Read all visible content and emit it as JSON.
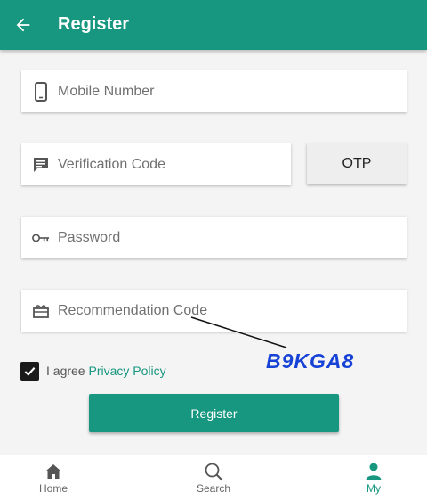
{
  "colors": {
    "primary": "#17977f",
    "annotation": "#1742d6"
  },
  "header": {
    "title": "Register",
    "back_icon": "arrow-left-icon"
  },
  "form": {
    "mobile": {
      "placeholder": "Mobile Number",
      "icon": "smartphone-icon"
    },
    "verification": {
      "placeholder": "Verification Code",
      "icon": "message-icon"
    },
    "otp_button": "OTP",
    "password": {
      "placeholder": "Password",
      "icon": "key-icon"
    },
    "recommendation": {
      "placeholder": "Recommendation Code",
      "icon": "gift-icon"
    },
    "agree": {
      "checked": true,
      "text": "I agree",
      "link": "Privacy Policy"
    },
    "register_button": "Register"
  },
  "annotation": {
    "code": "B9KGA8"
  },
  "bottom_nav": {
    "items": [
      {
        "label": "Home",
        "icon": "home-icon",
        "active": false
      },
      {
        "label": "Search",
        "icon": "search-icon",
        "active": false
      },
      {
        "label": "My",
        "icon": "person-icon",
        "active": true
      }
    ]
  }
}
